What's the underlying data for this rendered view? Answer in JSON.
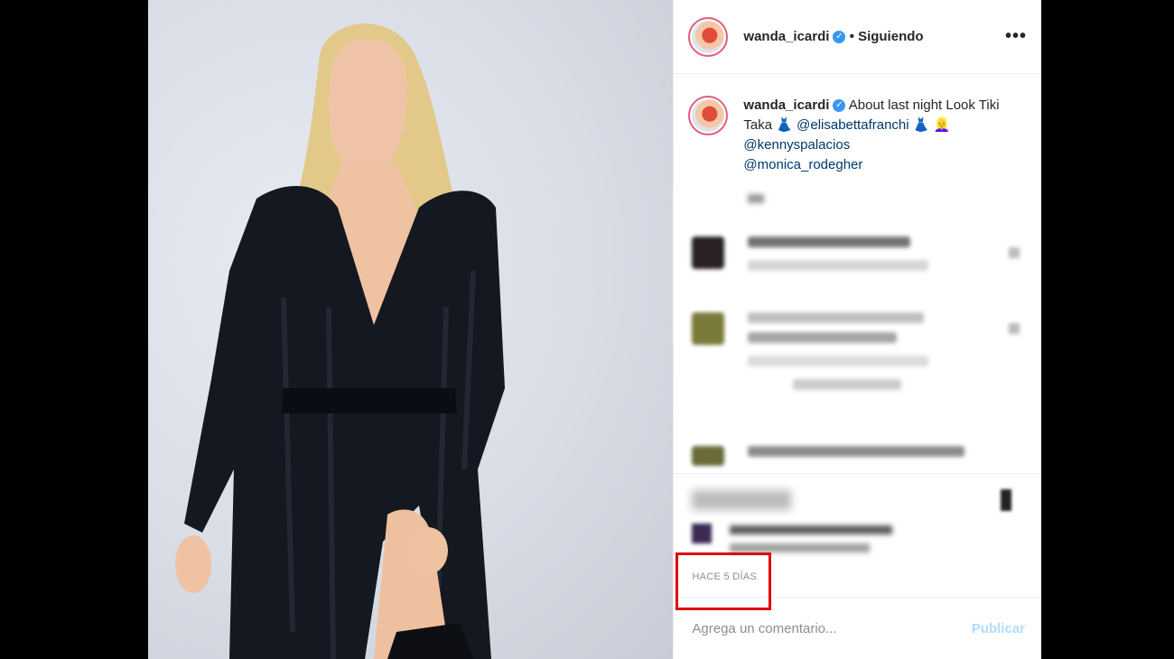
{
  "header": {
    "username": "wanda_icardi",
    "verified_icon": "verified-badge-icon",
    "separator": "•",
    "follow_status": "Siguiendo",
    "more_icon": "•••"
  },
  "caption": {
    "username": "wanda_icardi",
    "text_start": "About last night Look Tiki Taka",
    "dress_emoji": "👗",
    "mention_1": "@elisabettafranchi",
    "emojis_1": "👗 👱‍♀️",
    "mention_2": "@kennyspalacios",
    "mention_3": "@monica_rodegher"
  },
  "timestamp": "HACE 5 DÍAS",
  "comment_box": {
    "placeholder": "Agrega un comentario...",
    "publish_label": "Publicar"
  },
  "colors": {
    "accent_link": "#00376b",
    "publish_disabled": "#b3dbff",
    "highlight_box": "#e00000"
  }
}
